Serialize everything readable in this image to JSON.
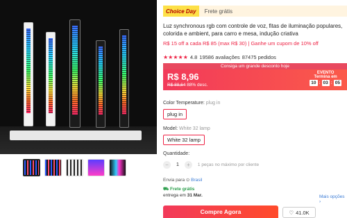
{
  "product_images": {
    "thumbnails": [
      "thumb-1",
      "thumb-2",
      "thumb-3",
      "thumb-4",
      "thumb-5"
    ]
  },
  "badge": {
    "choice": "Choice Day",
    "shipping": "Frete grátis"
  },
  "title": "Luz synchronous rgb com controle de voz, fitas de iluminação populares, colorida e ambient, para carro e mesa, indução criativa",
  "coupon": "R$ 15 off a cada R$ 85 (max R$ 30) | Ganhe um cupom de 10% off",
  "rating": {
    "stars": "★★★★★",
    "score": "4.8",
    "reviews": "19586 avaliações",
    "orders": "87475 pedidos"
  },
  "deal_banner": "Consiga um grande desconto hoje",
  "price": {
    "current": "R$ 8,96",
    "original": "R$ 88,64",
    "discount": "88% desc."
  },
  "event": {
    "label": "EVENTO",
    "sub": "Termina em",
    "h": "10",
    "m": "03",
    "s": "05"
  },
  "color_temp": {
    "label": "Color Temperature:",
    "value": "plug in",
    "option": "plug in"
  },
  "model": {
    "label": "Model:",
    "value": "White 32 lamp",
    "option": "White 32 lamp"
  },
  "quantity": {
    "label": "Quantidade:",
    "minus": "−",
    "value": "1",
    "plus": "+",
    "hint": "1 peças no máximo por cliente"
  },
  "shipping": {
    "to_label": "Envia para",
    "country": "Brasil",
    "free": "Frete grátis",
    "delivery_prefix": "entrega em",
    "delivery_date": "31 Mar.",
    "more": "Mais opções"
  },
  "actions": {
    "buy": "Compre Agora",
    "wishlist_count": "41.0K"
  },
  "colors": {
    "accent": "#f23a5a",
    "choice_yellow": "#fde047",
    "link": "#3a7bd5",
    "green": "#2a9d4a"
  }
}
